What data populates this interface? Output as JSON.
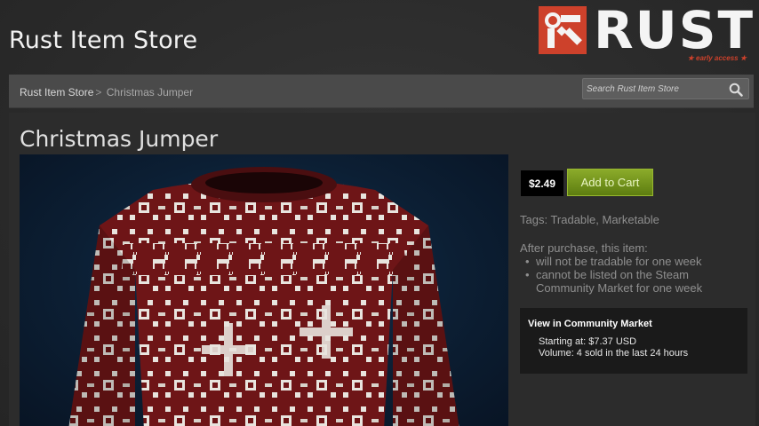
{
  "header": {
    "store_title": "Rust Item Store",
    "logo_text": "RUST",
    "logo_subtext": "★ early access ★",
    "brand_color": "#cd412b"
  },
  "breadcrumb": {
    "root": "Rust Item Store",
    "separator": ">",
    "current": "Christmas Jumper"
  },
  "search": {
    "placeholder": "Search Rust Item Store",
    "value": ""
  },
  "item": {
    "title": "Christmas Jumper",
    "image_icon": "sweater-icon",
    "price": "$2.49",
    "add_to_cart_label": "Add to Cart",
    "tags": "Tags: Tradable, Marketable",
    "after_purchase_heading": "After purchase, this item:",
    "restrictions": [
      "will not be tradable for one week",
      "cannot be listed on the Steam Community Market for one week"
    ]
  },
  "market": {
    "link_label": "View in Community Market",
    "starting_at": "Starting at: $7.37 USD",
    "volume": "Volume: 4 sold in the last 24 hours"
  },
  "colors": {
    "accent_green": "#7a9a1e",
    "sweater_red": "#6e1517",
    "pattern_white": "#e8e4de"
  }
}
